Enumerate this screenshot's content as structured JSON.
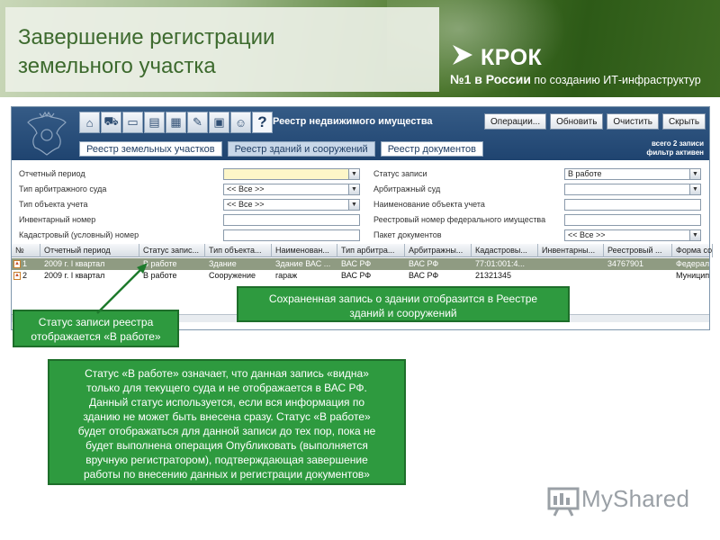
{
  "slide": {
    "title_line1": "Завершение регистрации",
    "title_line2": "земельного участка",
    "brand": "КРОК",
    "slogan_rank": "№1 в России",
    "slogan_rest": " по созданию ИТ-инфраструктур",
    "watermark": "MyShared"
  },
  "app": {
    "registry_title": "Реестр недвижимого имущества",
    "help_icon_glyph": "?",
    "buttons": [
      "Операции...",
      "Обновить",
      "Очистить",
      "Скрыть"
    ],
    "tabs": [
      "Реестр земельных участков",
      "Реестр зданий и сооружений",
      "Реестр документов"
    ],
    "active_tab": 1,
    "records_total": "всего 2 записи",
    "filter_state": "фильтр активен"
  },
  "filters": {
    "left": [
      {
        "label": "Отчетный период",
        "value": "",
        "dropdown": true,
        "yellow": true
      },
      {
        "label": "Тип арбитражного суда",
        "value": "<< Все >>",
        "dropdown": true,
        "yellow": false
      },
      {
        "label": "Тип объекта учета",
        "value": "<< Все >>",
        "dropdown": true,
        "yellow": false
      },
      {
        "label": "Инвентарный номер",
        "value": "",
        "dropdown": false,
        "yellow": false
      },
      {
        "label": "Кадастровый (условный) номер",
        "value": "",
        "dropdown": false,
        "yellow": false
      }
    ],
    "right": [
      {
        "label": "Статус записи",
        "value": "В работе",
        "dropdown": true,
        "yellow": false
      },
      {
        "label": "Арбитражный суд",
        "value": "",
        "dropdown": true,
        "yellow": false
      },
      {
        "label": "Наименование объекта учета",
        "value": "",
        "dropdown": false,
        "yellow": false
      },
      {
        "label": "Реестровый номер федерального имущества",
        "value": "",
        "dropdown": false,
        "yellow": false
      },
      {
        "label": "Пакет документов",
        "value": "<< Все >>",
        "dropdown": true,
        "yellow": false
      }
    ]
  },
  "grid": {
    "columns": [
      "№",
      "Отчетный период",
      "Статус запис...",
      "Тип объекта...",
      "Наименован...",
      "Тип арбитра...",
      "Арбитражны...",
      "Кадастровы...",
      "Инвентарны...",
      "Реестровый ...",
      "Форма со"
    ],
    "rows": [
      {
        "selected": true,
        "cells": [
          "1",
          "2009 г. I квартал",
          "В работе",
          "Здание",
          "Здание ВАС ...",
          "ВАС РФ",
          "ВАС РФ",
          "77:01:001:4...",
          "",
          "34767901",
          "Федерал"
        ]
      },
      {
        "selected": false,
        "cells": [
          "2",
          "2009 г. I квартал",
          "В работе",
          "Сооружение",
          "гараж",
          "ВАС РФ",
          "ВАС РФ",
          "21321345",
          "",
          "",
          "Муницип"
        ]
      }
    ]
  },
  "callouts": {
    "status_line1": "Статус записи реестра",
    "status_line2": "отображается «В работе»",
    "saved_line1": "Сохраненная запись о здании отобразится в Реестре",
    "saved_line2": "зданий и сооружений",
    "explain": [
      "Статус «В работе» означает, что данная запись «видна»",
      "только для текущего суда и не отображается в ВАС РФ.",
      "Данный статус используется, если  вся информация по",
      "зданию не может быть внесена сразу. Статус «В работе»",
      "будет отображаться для данной записи до тех пор, пока не",
      "будет выполнена операция Опубликовать (выполняется",
      "вручную регистратором), подтверждающая завершение",
      "работы по внесению данных и регистрации документов»"
    ]
  },
  "colors": {
    "callout_green": "#2e9a3f",
    "title_green": "#3d6a2e",
    "app_header_blue": "#1f4470",
    "selected_row": "#8f9b82"
  }
}
